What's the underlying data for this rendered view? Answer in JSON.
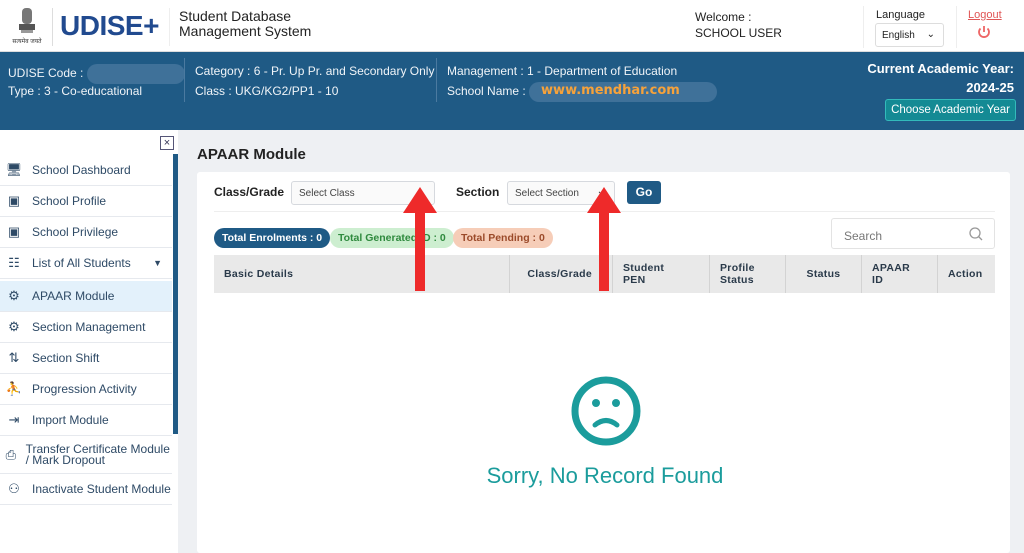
{
  "header": {
    "emblem_text": "सत्यमेव जयते",
    "logo": "UDISE+",
    "system_title_line1": "Student Database",
    "system_title_line2": "Management System",
    "welcome": "Welcome :",
    "user": "SCHOOL USER",
    "language_label": "Language",
    "language_value": "English",
    "logout": "Logout"
  },
  "school_band": {
    "udise_code_label": "UDISE Code :",
    "type": "Type : 3 - Co-educational",
    "category": "Category : 6 - Pr. Up Pr. and Secondary Only",
    "class": "Class : UKG/KG2/PP1 - 10",
    "management": "Management : 1 - Department of Education",
    "school_name_label": "School Name :",
    "school_name_watermark": "www.mendhar.com",
    "academic_year_label": "Current Academic Year:",
    "academic_year": "2024-25",
    "choose_year_button": "Choose Academic Year"
  },
  "sidebar": {
    "items": [
      {
        "label": "School Dashboard",
        "icon": "dashboard-icon"
      },
      {
        "label": "School Profile",
        "icon": "profile-icon"
      },
      {
        "label": "School Privilege",
        "icon": "privilege-icon"
      },
      {
        "label": "List of All Students",
        "icon": "list-icon"
      },
      {
        "label": "APAAR Module",
        "icon": "group-gear-icon",
        "active": true
      },
      {
        "label": "Section Management",
        "icon": "group-gear-icon"
      },
      {
        "label": "Section Shift",
        "icon": "shift-icon"
      },
      {
        "label": "Progression Activity",
        "icon": "progression-icon"
      },
      {
        "label": "Import Module",
        "icon": "import-icon"
      },
      {
        "label": "Transfer Certificate Module / Mark Dropout",
        "icon": "certificate-icon"
      },
      {
        "label": "Inactivate Student Module",
        "icon": "inactivate-user-icon"
      }
    ]
  },
  "main": {
    "title": "APAAR Module",
    "class_label": "Class/Grade",
    "class_placeholder": "Select Class",
    "section_label": "Section",
    "section_placeholder": "Select Section",
    "go_button": "Go",
    "badges": {
      "enrolments": "Total Enrolments : 0",
      "generated": "Total Generated ID : 0",
      "pending": "Total Pending : 0"
    },
    "search_placeholder": "Search",
    "columns": [
      "Basic Details",
      "Class/Grade",
      "Student PEN",
      "Profile Status",
      "Status",
      "APAAR ID",
      "Action"
    ],
    "empty_message": "Sorry, No Record Found"
  },
  "colors": {
    "brand_blue": "#1f5a85",
    "teal": "#1b9c9c",
    "arrow_red": "#ee2a2a"
  }
}
